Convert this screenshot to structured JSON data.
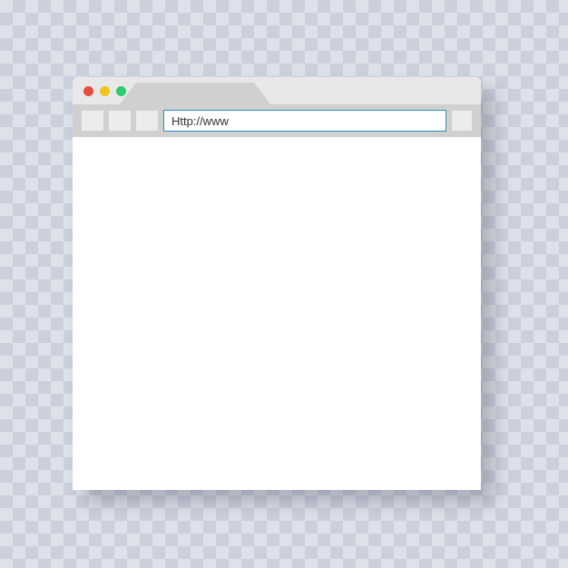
{
  "window": {
    "controls": {
      "close_color": "#e84c3d",
      "minimize_color": "#f0c419",
      "maximize_color": "#2dcc70"
    }
  },
  "toolbar": {
    "address_value": "Http://www"
  }
}
